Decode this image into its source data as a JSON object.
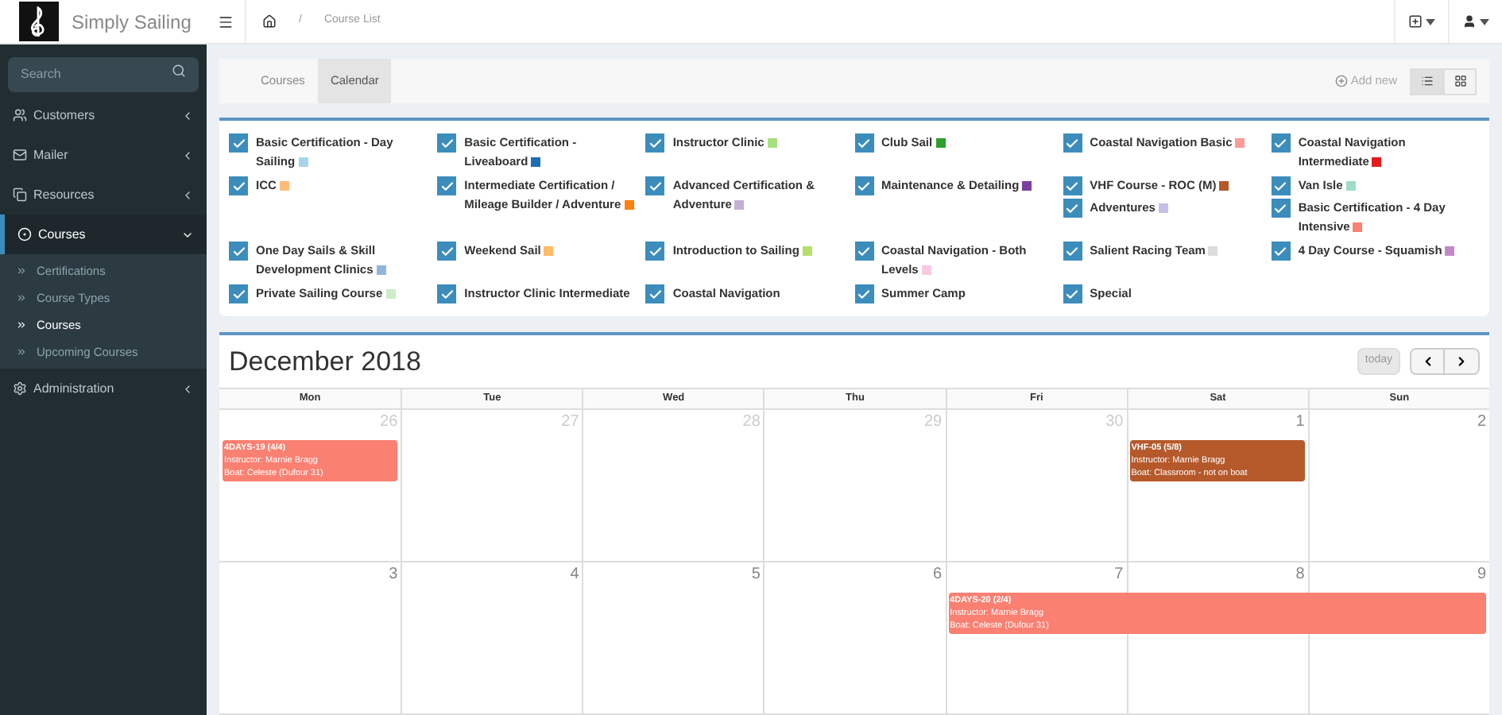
{
  "brand": {
    "name": "Simply Sailing"
  },
  "sidebar": {
    "search": {
      "placeholder": "Search"
    },
    "items": [
      {
        "label": "Customers",
        "expanded": false
      },
      {
        "label": "Mailer",
        "expanded": false
      },
      {
        "label": "Resources",
        "expanded": false
      },
      {
        "label": "Courses",
        "expanded": true,
        "children": [
          {
            "label": "Certifications",
            "selected": false
          },
          {
            "label": "Course Types",
            "selected": false
          },
          {
            "label": "Courses",
            "selected": true
          },
          {
            "label": "Upcoming Courses",
            "selected": false
          }
        ]
      },
      {
        "label": "Administration",
        "expanded": false
      }
    ]
  },
  "breadcrumb": {
    "separator": "/",
    "page": "Course List"
  },
  "tabs": [
    {
      "label": "Courses",
      "selected": false
    },
    {
      "label": "Calendar",
      "selected": true
    }
  ],
  "add_new": "Add new",
  "view_toggle": [
    {
      "kind": "list",
      "selected": true
    },
    {
      "kind": "grid",
      "selected": false
    }
  ],
  "legend": {
    "rows": [
      [
        [
          {
            "label": "Basic Certification - Day Sailing",
            "checked": true,
            "color": "#a9d3ea"
          }
        ],
        [
          {
            "label": "Basic Certification - Liveaboard",
            "checked": true,
            "color": "#1f6db3"
          }
        ],
        [
          {
            "label": "Instructor Clinic",
            "checked": true,
            "color": "#a8e07e"
          }
        ],
        [
          {
            "label": "Club Sail",
            "checked": true,
            "color": "#2ca02c"
          }
        ],
        [
          {
            "label": "Coastal Navigation Basic",
            "checked": true,
            "color": "#ff9a98"
          }
        ],
        [
          {
            "label": "Coastal Navigation Intermediate",
            "checked": true,
            "color": "#e51b1b"
          }
        ]
      ],
      [
        [
          {
            "label": "ICC",
            "checked": true,
            "color": "#ffbb78"
          }
        ],
        [
          {
            "label": "Intermediate Certification / Mileage Builder / Adventure",
            "checked": true,
            "color": "#ff7f0e"
          }
        ],
        [
          {
            "label": "Advanced Certification & Adventure",
            "checked": true,
            "color": "#c5b0d5"
          }
        ],
        [
          {
            "label": "Maintenance & Detailing",
            "checked": true,
            "color": "#7b3fa0"
          }
        ],
        [
          {
            "label": "VHF Course - ROC (M)",
            "checked": true,
            "color": "#b5592b"
          },
          {
            "label": "Adventures",
            "checked": true,
            "color": "#c6c0e6"
          }
        ],
        [
          {
            "label": "Van Isle",
            "checked": true,
            "color": "#9fdcc9"
          },
          {
            "label": "Basic Certification - 4 Day Intensive",
            "checked": true,
            "color": "#fa8072"
          }
        ]
      ],
      [
        [
          {
            "label": "One Day Sails & Skill Development Clinics",
            "checked": true,
            "color": "#8fb6db"
          }
        ],
        [
          {
            "label": "Weekend Sail",
            "checked": true,
            "color": "#ffbb66"
          }
        ],
        [
          {
            "label": "Introduction to Sailing",
            "checked": true,
            "color": "#b5e06a"
          }
        ],
        [
          {
            "label": "Coastal Navigation - Both Levels",
            "checked": true,
            "color": "#fcc8e2"
          }
        ],
        [
          {
            "label": "Salient Racing Team",
            "checked": true,
            "color": "#dcdcdc"
          }
        ],
        [
          {
            "label": "4 Day Course - Squamish",
            "checked": true,
            "color": "#c288c8"
          }
        ]
      ],
      [
        [
          {
            "label": "Private Sailing Course",
            "checked": true,
            "color": "#cdeccb"
          }
        ],
        [
          {
            "label": "Instructor Clinic Intermediate",
            "checked": true
          }
        ],
        [
          {
            "label": "Coastal Navigation",
            "checked": true
          }
        ],
        [
          {
            "label": "Summer Camp",
            "checked": true
          }
        ],
        [
          {
            "label": "Special",
            "checked": true
          }
        ]
      ]
    ]
  },
  "calendar": {
    "title": "December 2018",
    "today_button": {
      "label": "today",
      "disabled": true
    },
    "weekdays": [
      "Mon",
      "Tue",
      "Wed",
      "Thu",
      "Fri",
      "Sat",
      "Sun"
    ],
    "weeks": [
      {
        "days": [
          {
            "number": "26",
            "other_month": true,
            "events": [
              {
                "title": "4DAYS-19 (4/4)",
                "instructor": "Instructor: Marnie Bragg",
                "boat": "Boat: Celeste (Dufour 31)",
                "color": "#fa8072",
                "through_end_of_week": false
              }
            ]
          },
          {
            "number": "27",
            "other_month": true
          },
          {
            "number": "28",
            "other_month": true
          },
          {
            "number": "29",
            "other_month": true
          },
          {
            "number": "30",
            "other_month": true
          },
          {
            "number": "1",
            "other_month": false,
            "events": [
              {
                "title": "VHF-05 (5/8)",
                "instructor": "Instructor: Marnie Bragg",
                "boat": "Boat: Classroom - not on boat",
                "color": "#b5592b",
                "through_end_of_week": false
              }
            ]
          },
          {
            "number": "2",
            "other_month": false
          }
        ]
      },
      {
        "days": [
          {
            "number": "3",
            "other_month": false
          },
          {
            "number": "4",
            "other_month": false
          },
          {
            "number": "5",
            "other_month": false
          },
          {
            "number": "6",
            "other_month": false
          },
          {
            "number": "7",
            "other_month": false,
            "events": [
              {
                "title": "4DAYS-20 (2/4)",
                "instructor": "Instructor: Marnie Bragg",
                "boat": "Boat: Celeste (Dufour 31)",
                "color": "#fa8072",
                "through_end_of_week": true
              }
            ]
          },
          {
            "number": "8",
            "other_month": false
          },
          {
            "number": "9",
            "other_month": false
          }
        ]
      }
    ]
  }
}
